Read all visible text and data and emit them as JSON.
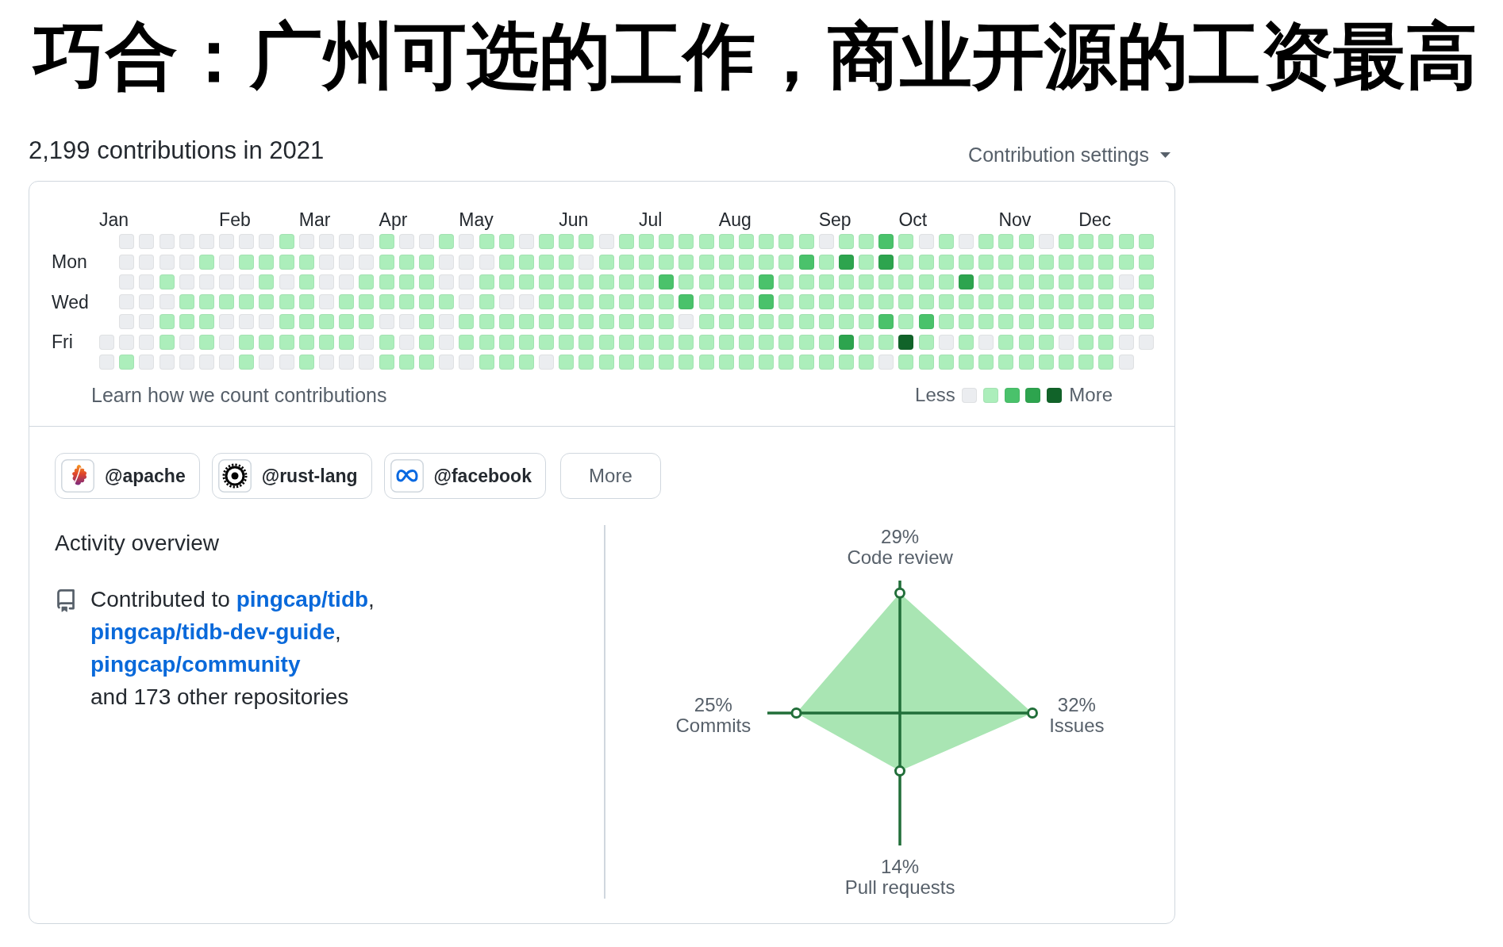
{
  "title": "巧合：广州可选的工作，商业开源的工资最高",
  "contributions": {
    "heading": "2,199 contributions in 2021",
    "settings_button": "Contribution settings"
  },
  "calendar": {
    "weekday_labels": [
      "Mon",
      "Wed",
      "Fri"
    ],
    "weeks": [
      {
        "month": "Jan",
        "days": [
          {
            "color": "#ebedf0"
          },
          {
            "color": "#ebedf0"
          }
        ]
      },
      {
        "days": [
          {
            "color": "#ebedf0"
          },
          {
            "color": "#ebedf0"
          },
          {
            "color": "#ebedf0"
          },
          {
            "color": "#ebedf0"
          },
          {
            "color": "#ebedf0"
          },
          {
            "color": "#ebedf0"
          },
          {
            "color": "#aceebb"
          }
        ]
      },
      {
        "days": [
          {
            "color": "#ebedf0"
          },
          {
            "color": "#ebedf0"
          },
          {
            "color": "#ebedf0"
          },
          {
            "color": "#ebedf0"
          },
          {
            "color": "#ebedf0"
          },
          {
            "color": "#ebedf0"
          },
          {
            "color": "#ebedf0"
          }
        ]
      },
      {
        "days": [
          {
            "color": "#ebedf0"
          },
          {
            "color": "#ebedf0"
          },
          {
            "color": "#aceebb"
          },
          {
            "color": "#ebedf0"
          },
          {
            "color": "#aceebb"
          },
          {
            "color": "#aceebb"
          },
          {
            "color": "#ebedf0"
          }
        ]
      },
      {
        "days": [
          {
            "color": "#ebedf0"
          },
          {
            "color": "#ebedf0"
          },
          {
            "color": "#ebedf0"
          },
          {
            "color": "#aceebb"
          },
          {
            "color": "#aceebb"
          },
          {
            "color": "#ebedf0"
          },
          {
            "color": "#ebedf0"
          }
        ]
      },
      {
        "days": [
          {
            "color": "#ebedf0"
          },
          {
            "color": "#aceebb"
          },
          {
            "color": "#ebedf0"
          },
          {
            "color": "#aceebb"
          },
          {
            "color": "#aceebb"
          },
          {
            "color": "#aceebb"
          },
          {
            "color": "#ebedf0"
          }
        ]
      },
      {
        "month": "Feb",
        "days": [
          {
            "color": "#ebedf0"
          },
          {
            "color": "#ebedf0"
          },
          {
            "color": "#ebedf0"
          },
          {
            "color": "#aceebb"
          },
          {
            "color": "#ebedf0"
          },
          {
            "color": "#ebedf0"
          },
          {
            "color": "#ebedf0"
          }
        ]
      },
      {
        "days": [
          {
            "color": "#ebedf0"
          },
          {
            "color": "#aceebb"
          },
          {
            "color": "#ebedf0"
          },
          {
            "color": "#aceebb"
          },
          {
            "color": "#ebedf0"
          },
          {
            "color": "#aceebb"
          },
          {
            "color": "#aceebb"
          }
        ]
      },
      {
        "days": [
          {
            "color": "#ebedf0"
          },
          {
            "color": "#aceebb"
          },
          {
            "color": "#aceebb"
          },
          {
            "color": "#aceebb"
          },
          {
            "color": "#ebedf0"
          },
          {
            "color": "#aceebb"
          },
          {
            "color": "#ebedf0"
          }
        ]
      },
      {
        "days": [
          {
            "color": "#aceebb"
          },
          {
            "color": "#aceebb"
          },
          {
            "color": "#ebedf0"
          },
          {
            "color": "#aceebb"
          },
          {
            "color": "#aceebb"
          },
          {
            "color": "#aceebb"
          },
          {
            "color": "#ebedf0"
          }
        ]
      },
      {
        "month": "Mar",
        "days": [
          {
            "color": "#ebedf0"
          },
          {
            "color": "#aceebb"
          },
          {
            "color": "#aceebb"
          },
          {
            "color": "#aceebb"
          },
          {
            "color": "#aceebb"
          },
          {
            "color": "#aceebb"
          },
          {
            "color": "#aceebb"
          }
        ]
      },
      {
        "days": [
          {
            "color": "#ebedf0"
          },
          {
            "color": "#ebedf0"
          },
          {
            "color": "#ebedf0"
          },
          {
            "color": "#ebedf0"
          },
          {
            "color": "#aceebb"
          },
          {
            "color": "#aceebb"
          },
          {
            "color": "#ebedf0"
          }
        ]
      },
      {
        "days": [
          {
            "color": "#ebedf0"
          },
          {
            "color": "#ebedf0"
          },
          {
            "color": "#ebedf0"
          },
          {
            "color": "#aceebb"
          },
          {
            "color": "#aceebb"
          },
          {
            "color": "#aceebb"
          },
          {
            "color": "#ebedf0"
          }
        ]
      },
      {
        "days": [
          {
            "color": "#ebedf0"
          },
          {
            "color": "#ebedf0"
          },
          {
            "color": "#aceebb"
          },
          {
            "color": "#aceebb"
          },
          {
            "color": "#aceebb"
          },
          {
            "color": "#ebedf0"
          },
          {
            "color": "#ebedf0"
          }
        ]
      },
      {
        "month": "Apr",
        "days": [
          {
            "color": "#aceebb"
          },
          {
            "color": "#aceebb"
          },
          {
            "color": "#aceebb"
          },
          {
            "color": "#aceebb"
          },
          {
            "color": "#ebedf0"
          },
          {
            "color": "#aceebb"
          },
          {
            "color": "#aceebb"
          }
        ]
      },
      {
        "days": [
          {
            "color": "#ebedf0"
          },
          {
            "color": "#aceebb"
          },
          {
            "color": "#aceebb"
          },
          {
            "color": "#aceebb"
          },
          {
            "color": "#ebedf0"
          },
          {
            "color": "#ebedf0"
          },
          {
            "color": "#aceebb"
          }
        ]
      },
      {
        "days": [
          {
            "color": "#ebedf0"
          },
          {
            "color": "#aceebb"
          },
          {
            "color": "#aceebb"
          },
          {
            "color": "#aceebb"
          },
          {
            "color": "#aceebb"
          },
          {
            "color": "#aceebb"
          },
          {
            "color": "#aceebb"
          }
        ]
      },
      {
        "days": [
          {
            "color": "#aceebb"
          },
          {
            "color": "#ebedf0"
          },
          {
            "color": "#ebedf0"
          },
          {
            "color": "#aceebb"
          },
          {
            "color": "#ebedf0"
          },
          {
            "color": "#ebedf0"
          },
          {
            "color": "#ebedf0"
          }
        ]
      },
      {
        "month": "May",
        "days": [
          {
            "color": "#ebedf0"
          },
          {
            "color": "#ebedf0"
          },
          {
            "color": "#ebedf0"
          },
          {
            "color": "#ebedf0"
          },
          {
            "color": "#aceebb"
          },
          {
            "color": "#aceebb"
          },
          {
            "color": "#ebedf0"
          }
        ]
      },
      {
        "days": [
          {
            "color": "#aceebb"
          },
          {
            "color": "#ebedf0"
          },
          {
            "color": "#aceebb"
          },
          {
            "color": "#aceebb"
          },
          {
            "color": "#aceebb"
          },
          {
            "color": "#aceebb"
          },
          {
            "color": "#aceebb"
          }
        ]
      },
      {
        "days": [
          {
            "color": "#aceebb"
          },
          {
            "color": "#aceebb"
          },
          {
            "color": "#aceebb"
          },
          {
            "color": "#ebedf0"
          },
          {
            "color": "#aceebb"
          },
          {
            "color": "#aceebb"
          },
          {
            "color": "#aceebb"
          }
        ]
      },
      {
        "days": [
          {
            "color": "#ebedf0"
          },
          {
            "color": "#aceebb"
          },
          {
            "color": "#aceebb"
          },
          {
            "color": "#ebedf0"
          },
          {
            "color": "#aceebb"
          },
          {
            "color": "#aceebb"
          },
          {
            "color": "#aceebb"
          }
        ]
      },
      {
        "days": [
          {
            "color": "#aceebb"
          },
          {
            "color": "#aceebb"
          },
          {
            "color": "#aceebb"
          },
          {
            "color": "#aceebb"
          },
          {
            "color": "#aceebb"
          },
          {
            "color": "#aceebb"
          },
          {
            "color": "#ebedf0"
          }
        ]
      },
      {
        "month": "Jun",
        "days": [
          {
            "color": "#aceebb"
          },
          {
            "color": "#aceebb"
          },
          {
            "color": "#aceebb"
          },
          {
            "color": "#aceebb"
          },
          {
            "color": "#aceebb"
          },
          {
            "color": "#aceebb"
          },
          {
            "color": "#aceebb"
          }
        ]
      },
      {
        "days": [
          {
            "color": "#aceebb"
          },
          {
            "color": "#ebedf0"
          },
          {
            "color": "#aceebb"
          },
          {
            "color": "#aceebb"
          },
          {
            "color": "#aceebb"
          },
          {
            "color": "#aceebb"
          },
          {
            "color": "#aceebb"
          }
        ]
      },
      {
        "days": [
          {
            "color": "#ebedf0"
          },
          {
            "color": "#aceebb"
          },
          {
            "color": "#aceebb"
          },
          {
            "color": "#aceebb"
          },
          {
            "color": "#aceebb"
          },
          {
            "color": "#aceebb"
          },
          {
            "color": "#aceebb"
          }
        ]
      },
      {
        "days": [
          {
            "color": "#aceebb"
          },
          {
            "color": "#aceebb"
          },
          {
            "color": "#aceebb"
          },
          {
            "color": "#aceebb"
          },
          {
            "color": "#aceebb"
          },
          {
            "color": "#aceebb"
          },
          {
            "color": "#aceebb"
          }
        ]
      },
      {
        "month": "Jul",
        "days": [
          {
            "color": "#aceebb"
          },
          {
            "color": "#aceebb"
          },
          {
            "color": "#aceebb"
          },
          {
            "color": "#aceebb"
          },
          {
            "color": "#aceebb"
          },
          {
            "color": "#aceebb"
          },
          {
            "color": "#aceebb"
          }
        ]
      },
      {
        "days": [
          {
            "color": "#aceebb"
          },
          {
            "color": "#aceebb"
          },
          {
            "color": "#4ac26b"
          },
          {
            "color": "#aceebb"
          },
          {
            "color": "#aceebb"
          },
          {
            "color": "#aceebb"
          },
          {
            "color": "#aceebb"
          }
        ]
      },
      {
        "days": [
          {
            "color": "#aceebb"
          },
          {
            "color": "#aceebb"
          },
          {
            "color": "#aceebb"
          },
          {
            "color": "#4ac26b"
          },
          {
            "color": "#ebedf0"
          },
          {
            "color": "#aceebb"
          },
          {
            "color": "#aceebb"
          }
        ]
      },
      {
        "days": [
          {
            "color": "#aceebb"
          },
          {
            "color": "#aceebb"
          },
          {
            "color": "#aceebb"
          },
          {
            "color": "#aceebb"
          },
          {
            "color": "#aceebb"
          },
          {
            "color": "#aceebb"
          },
          {
            "color": "#aceebb"
          }
        ]
      },
      {
        "month": "Aug",
        "days": [
          {
            "color": "#aceebb"
          },
          {
            "color": "#aceebb"
          },
          {
            "color": "#aceebb"
          },
          {
            "color": "#aceebb"
          },
          {
            "color": "#aceebb"
          },
          {
            "color": "#aceebb"
          },
          {
            "color": "#aceebb"
          }
        ]
      },
      {
        "days": [
          {
            "color": "#aceebb"
          },
          {
            "color": "#aceebb"
          },
          {
            "color": "#aceebb"
          },
          {
            "color": "#aceebb"
          },
          {
            "color": "#aceebb"
          },
          {
            "color": "#aceebb"
          },
          {
            "color": "#aceebb"
          }
        ]
      },
      {
        "days": [
          {
            "color": "#aceebb"
          },
          {
            "color": "#aceebb"
          },
          {
            "color": "#4ac26b"
          },
          {
            "color": "#4ac26b"
          },
          {
            "color": "#aceebb"
          },
          {
            "color": "#aceebb"
          },
          {
            "color": "#aceebb"
          }
        ]
      },
      {
        "days": [
          {
            "color": "#aceebb"
          },
          {
            "color": "#aceebb"
          },
          {
            "color": "#aceebb"
          },
          {
            "color": "#aceebb"
          },
          {
            "color": "#aceebb"
          },
          {
            "color": "#aceebb"
          },
          {
            "color": "#aceebb"
          }
        ]
      },
      {
        "days": [
          {
            "color": "#aceebb"
          },
          {
            "color": "#4ac26b"
          },
          {
            "color": "#aceebb"
          },
          {
            "color": "#aceebb"
          },
          {
            "color": "#aceebb"
          },
          {
            "color": "#aceebb"
          },
          {
            "color": "#aceebb"
          }
        ]
      },
      {
        "month": "Sep",
        "days": [
          {
            "color": "#ebedf0"
          },
          {
            "color": "#aceebb"
          },
          {
            "color": "#aceebb"
          },
          {
            "color": "#aceebb"
          },
          {
            "color": "#aceebb"
          },
          {
            "color": "#aceebb"
          },
          {
            "color": "#aceebb"
          }
        ]
      },
      {
        "days": [
          {
            "color": "#aceebb"
          },
          {
            "color": "#2da44e"
          },
          {
            "color": "#aceebb"
          },
          {
            "color": "#aceebb"
          },
          {
            "color": "#aceebb"
          },
          {
            "color": "#2da44e"
          },
          {
            "color": "#aceebb"
          }
        ]
      },
      {
        "days": [
          {
            "color": "#aceebb"
          },
          {
            "color": "#aceebb"
          },
          {
            "color": "#aceebb"
          },
          {
            "color": "#aceebb"
          },
          {
            "color": "#aceebb"
          },
          {
            "color": "#aceebb"
          },
          {
            "color": "#aceebb"
          }
        ]
      },
      {
        "days": [
          {
            "color": "#4ac26b"
          },
          {
            "color": "#2da44e"
          },
          {
            "color": "#aceebb"
          },
          {
            "color": "#aceebb"
          },
          {
            "color": "#4ac26b"
          },
          {
            "color": "#aceebb"
          },
          {
            "color": "#ebedf0"
          }
        ]
      },
      {
        "month": "Oct",
        "days": [
          {
            "color": "#aceebb"
          },
          {
            "color": "#aceebb"
          },
          {
            "color": "#aceebb"
          },
          {
            "color": "#aceebb"
          },
          {
            "color": "#aceebb"
          },
          {
            "color": "#116329"
          },
          {
            "color": "#aceebb"
          }
        ]
      },
      {
        "days": [
          {
            "color": "#ebedf0"
          },
          {
            "color": "#aceebb"
          },
          {
            "color": "#aceebb"
          },
          {
            "color": "#aceebb"
          },
          {
            "color": "#4ac26b"
          },
          {
            "color": "#aceebb"
          },
          {
            "color": "#aceebb"
          }
        ]
      },
      {
        "days": [
          {
            "color": "#aceebb"
          },
          {
            "color": "#aceebb"
          },
          {
            "color": "#aceebb"
          },
          {
            "color": "#aceebb"
          },
          {
            "color": "#aceebb"
          },
          {
            "color": "#ebedf0"
          },
          {
            "color": "#aceebb"
          }
        ]
      },
      {
        "days": [
          {
            "color": "#ebedf0"
          },
          {
            "color": "#aceebb"
          },
          {
            "color": "#2da44e"
          },
          {
            "color": "#aceebb"
          },
          {
            "color": "#aceebb"
          },
          {
            "color": "#aceebb"
          },
          {
            "color": "#aceebb"
          }
        ]
      },
      {
        "days": [
          {
            "color": "#aceebb"
          },
          {
            "color": "#aceebb"
          },
          {
            "color": "#aceebb"
          },
          {
            "color": "#aceebb"
          },
          {
            "color": "#aceebb"
          },
          {
            "color": "#ebedf0"
          },
          {
            "color": "#aceebb"
          }
        ]
      },
      {
        "month": "Nov",
        "days": [
          {
            "color": "#aceebb"
          },
          {
            "color": "#aceebb"
          },
          {
            "color": "#aceebb"
          },
          {
            "color": "#aceebb"
          },
          {
            "color": "#aceebb"
          },
          {
            "color": "#aceebb"
          },
          {
            "color": "#aceebb"
          }
        ]
      },
      {
        "days": [
          {
            "color": "#aceebb"
          },
          {
            "color": "#aceebb"
          },
          {
            "color": "#aceebb"
          },
          {
            "color": "#aceebb"
          },
          {
            "color": "#aceebb"
          },
          {
            "color": "#aceebb"
          },
          {
            "color": "#aceebb"
          }
        ]
      },
      {
        "days": [
          {
            "color": "#ebedf0"
          },
          {
            "color": "#aceebb"
          },
          {
            "color": "#aceebb"
          },
          {
            "color": "#aceebb"
          },
          {
            "color": "#aceebb"
          },
          {
            "color": "#aceebb"
          },
          {
            "color": "#aceebb"
          }
        ]
      },
      {
        "days": [
          {
            "color": "#aceebb"
          },
          {
            "color": "#aceebb"
          },
          {
            "color": "#aceebb"
          },
          {
            "color": "#aceebb"
          },
          {
            "color": "#aceebb"
          },
          {
            "color": "#ebedf0"
          },
          {
            "color": "#aceebb"
          }
        ]
      },
      {
        "month": "Dec",
        "days": [
          {
            "color": "#aceebb"
          },
          {
            "color": "#aceebb"
          },
          {
            "color": "#aceebb"
          },
          {
            "color": "#aceebb"
          },
          {
            "color": "#aceebb"
          },
          {
            "color": "#aceebb"
          },
          {
            "color": "#aceebb"
          }
        ]
      },
      {
        "days": [
          {
            "color": "#aceebb"
          },
          {
            "color": "#aceebb"
          },
          {
            "color": "#aceebb"
          },
          {
            "color": "#aceebb"
          },
          {
            "color": "#aceebb"
          },
          {
            "color": "#aceebb"
          },
          {
            "color": "#aceebb"
          }
        ]
      },
      {
        "days": [
          {
            "color": "#aceebb"
          },
          {
            "color": "#aceebb"
          },
          {
            "color": "#ebedf0"
          },
          {
            "color": "#aceebb"
          },
          {
            "color": "#aceebb"
          },
          {
            "color": "#ebedf0"
          },
          {
            "color": "#ebedf0"
          }
        ]
      },
      {
        "days": [
          {
            "color": "#aceebb"
          },
          {
            "color": "#aceebb"
          },
          {
            "color": "#aceebb"
          },
          {
            "color": "#aceebb"
          },
          {
            "color": "#aceebb"
          },
          {
            "color": "#ebedf0"
          }
        ]
      }
    ],
    "footer_link": "Learn how we count contributions",
    "legend": {
      "less": "Less",
      "more": "More",
      "swatches": [
        {
          "color": "#ebedf0"
        },
        {
          "color": "#aceebb"
        },
        {
          "color": "#4ac26b"
        },
        {
          "color": "#2da44e"
        },
        {
          "color": "#116329"
        }
      ]
    }
  },
  "organizations": {
    "items": [
      {
        "kind": "leaf",
        "label": "@apache"
      },
      {
        "kind": "gear",
        "label": "@rust-lang"
      },
      {
        "kind": "infinity",
        "label": "@facebook"
      }
    ],
    "more_button": "More"
  },
  "activity": {
    "heading": "Activity overview",
    "summary_lines": [
      "Contributed to **pingcap/tidb**,",
      "**pingcap/tidb-dev-guide**,",
      "**pingcap/community**",
      "and 173 other repositories"
    ],
    "chart": {
      "top": {
        "percent": "29%",
        "caption": "Code review"
      },
      "left": {
        "percent": "25%",
        "caption": "Commits"
      },
      "right": {
        "percent": "32%",
        "caption": "Issues"
      },
      "bottom": {
        "percent": "14%",
        "caption": "Pull requests"
      }
    }
  }
}
